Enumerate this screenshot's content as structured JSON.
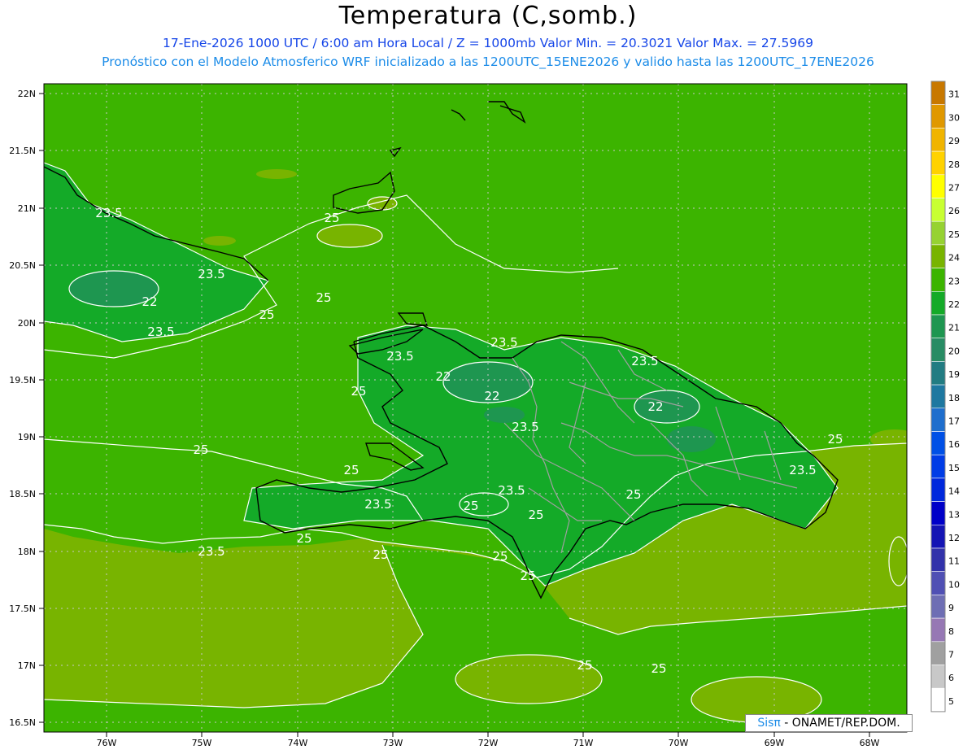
{
  "header": {
    "title": "Temperatura (C,somb.)",
    "line1": "17-Ene-2026  1000 UTC / 6:00 am Hora Local / Z = 1000mb    Valor Min. = 20.3021  Valor Max. = 27.5969",
    "line2": "Pronóstico con el Modelo Atmosferico WRF inicializado a las 1200UTC_15ENE2026 y valido hasta las  1200UTC_17ENE2026"
  },
  "map": {
    "lat_labels": [
      "22N",
      "21.5N",
      "21N",
      "20.5N",
      "20N",
      "19.5N",
      "19N",
      "18.5N",
      "18N",
      "17.5N",
      "17N",
      "16.5N"
    ],
    "lon_labels": [
      "76W",
      "75W",
      "74W",
      "73W",
      "72W",
      "71W",
      "70W",
      "69W",
      "68W"
    ],
    "contour_labels": [
      "23.5",
      "25",
      "23.5",
      "22",
      "23.5",
      "25",
      "25",
      "23.5",
      "22",
      "23.5",
      "22",
      "23.5",
      "22",
      "25",
      "25",
      "25",
      "23.5",
      "25",
      "23.5",
      "25",
      "23.5",
      "23.5",
      "25",
      "25",
      "25",
      "23.5",
      "25",
      "25",
      "25",
      "25",
      "25"
    ]
  },
  "colorbar": {
    "labels": [
      "31",
      "30",
      "29",
      "28",
      "27",
      "26",
      "25",
      "24",
      "23",
      "22",
      "21",
      "20",
      "19",
      "18",
      "17",
      "16",
      "15",
      "14",
      "13",
      "12",
      "11",
      "10",
      "9",
      "8",
      "7",
      "6",
      "5"
    ],
    "colors": [
      "#c87800",
      "#e09800",
      "#f0b400",
      "#ffd200",
      "#ffff00",
      "#c8ff32",
      "#96d232",
      "#78b400",
      "#3cb400",
      "#14aa28",
      "#1e9650",
      "#288c64",
      "#227c82",
      "#1e78a0",
      "#1e6ecd",
      "#0050e6",
      "#003ce6",
      "#0028dc",
      "#0000c8",
      "#1414b4",
      "#3232aa",
      "#5050b4",
      "#6e6eb4",
      "#9678b4",
      "#a0a0a0",
      "#c8c8c8",
      "#ffffff"
    ]
  },
  "credit": {
    "sis": "Sisπ",
    "rest": " - ONAMET/REP.DOM."
  }
}
